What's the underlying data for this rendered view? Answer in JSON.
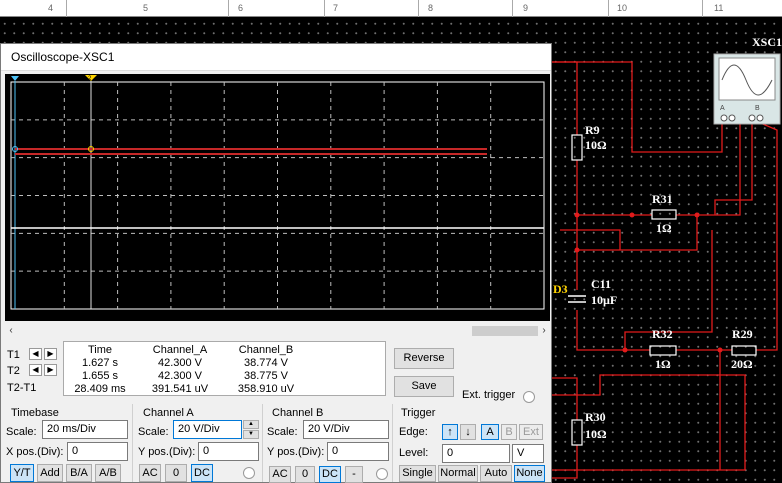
{
  "ruler": {
    "numbers": [
      "4",
      "5",
      "6",
      "7",
      "8",
      "9",
      "10",
      "11"
    ]
  },
  "schematic": {
    "instrument_label": "XSC1",
    "instrument_terminals": [
      "A",
      "B"
    ],
    "components": [
      {
        "ref": "R9",
        "value": "10Ω"
      },
      {
        "ref": "R31",
        "value": "1Ω"
      },
      {
        "ref": "C11",
        "value": "10µF"
      },
      {
        "ref": "D3"
      },
      {
        "ref": "R32",
        "value": "1Ω"
      },
      {
        "ref": "R29",
        "value": "20Ω"
      },
      {
        "ref": "R30",
        "value": "10Ω"
      }
    ]
  },
  "scope": {
    "title": "Oscilloscope-XSC1",
    "cursor_markers": [
      "1",
      "2"
    ],
    "traces": {
      "channel_a_color": "#c62828",
      "channel_b_color": "#ffffff"
    },
    "scroll": {
      "left": "‹",
      "right": "›"
    },
    "readout": {
      "headers": [
        "Time",
        "Channel_A",
        "Channel_B"
      ],
      "rows": [
        {
          "label": "T1",
          "time": "1.627 s",
          "a": "42.300 V",
          "b": "38.774 V"
        },
        {
          "label": "T2",
          "time": "1.655 s",
          "a": "42.300 V",
          "b": "38.775 V"
        },
        {
          "label": "T2-T1",
          "time": "28.409 ms",
          "a": "391.541 uV",
          "b": "358.910 uV"
        }
      ],
      "nudge_left": "◀",
      "nudge_right": "▶"
    },
    "reverse_label": "Reverse",
    "save_label": "Save",
    "ext_trigger_label": "Ext. trigger",
    "timebase": {
      "title": "Timebase",
      "scale_label": "Scale:",
      "scale_value": "20 ms/Div",
      "xpos_label": "X pos.(Div):",
      "xpos_value": "0",
      "modes": [
        "Y/T",
        "Add",
        "B/A",
        "A/B"
      ]
    },
    "channel_a": {
      "title": "Channel A",
      "scale_label": "Scale:",
      "scale_value": "20  V/Div",
      "ypos_label": "Y pos.(Div):",
      "ypos_value": "0",
      "coupling": [
        "AC",
        "0",
        "DC"
      ]
    },
    "channel_b": {
      "title": "Channel B",
      "scale_label": "Scale:",
      "scale_value": "20  V/Div",
      "ypos_label": "Y pos.(Div):",
      "ypos_value": "0",
      "coupling": [
        "AC",
        "0",
        "DC",
        "-"
      ]
    },
    "trigger": {
      "title": "Trigger",
      "edge_label": "Edge:",
      "level_label": "Level:",
      "level_value": "0",
      "level_unit": "V",
      "edge_rise": "↑",
      "edge_fall": "↓",
      "sources": [
        "A",
        "B",
        "Ext"
      ],
      "modes": [
        "Single",
        "Normal",
        "Auto",
        "None"
      ]
    }
  }
}
